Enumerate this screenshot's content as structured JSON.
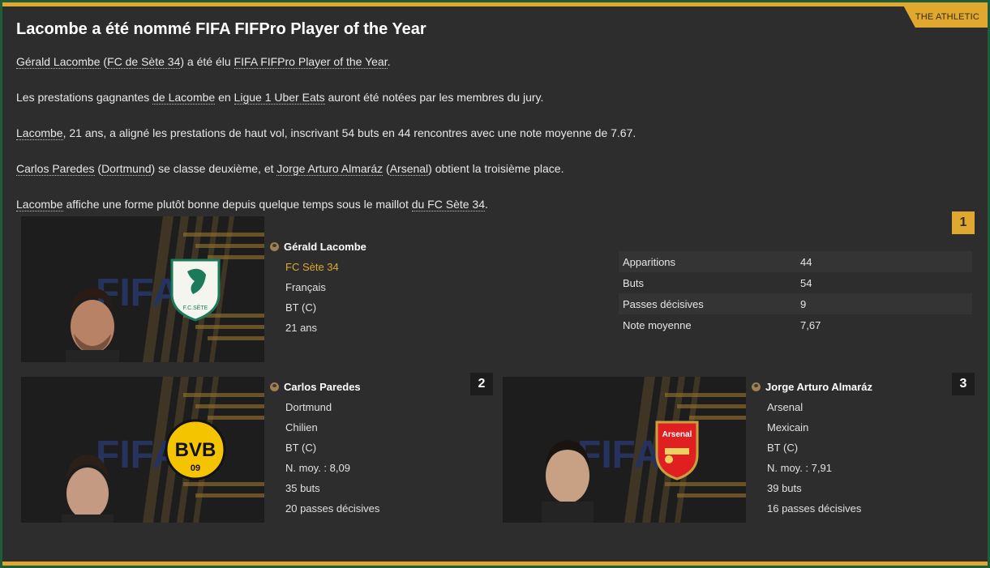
{
  "source": "THE ATHLETIC",
  "headline": "Lacombe a été nommé FIFA FIFPro Player of the Year",
  "paragraphs": {
    "p1": {
      "player": "Gérald Lacombe",
      "open": " (",
      "club": "FC de Sète 34",
      "mid": ") a été élu ",
      "award": "FIFA FIFPro Player of the Year",
      "end": "."
    },
    "p2": {
      "start": "Les prestations gagnantes ",
      "player": "de Lacombe",
      "mid": " en ",
      "league": "Ligue 1 Uber Eats",
      "end": " auront été notées par les membres du jury."
    },
    "p3": {
      "player": "Lacombe",
      "rest": ", 21 ans, a aligné les prestations de haut vol, inscrivant 54 buts en 44 rencontres avec une note moyenne de 7.67."
    },
    "p4": {
      "second": "Carlos Paredes",
      "open1": " (",
      "club2": "Dortmund",
      "mid": ") se classe deuxième, et ",
      "third": "Jorge Arturo Almaráz",
      "open2": " (",
      "club3": "Arsenal",
      "end": ") obtient la troisième place."
    },
    "p5": {
      "player": "Lacombe",
      "mid": " affiche une forme plutôt bonne depuis quelque temps sous le maillot ",
      "club": "du FC Sète 34",
      "end": "."
    }
  },
  "winner": {
    "rank": "1",
    "name": "Gérald Lacombe",
    "club": "FC Sète 34",
    "nationality": "Français",
    "position": "BT (C)",
    "age": "21 ans",
    "badge_text": "F.C.SÈTE",
    "banner_text": "FIFA",
    "stats": [
      {
        "label": "Apparitions",
        "value": "44"
      },
      {
        "label": "Buts",
        "value": "54"
      },
      {
        "label": "Passes décisives",
        "value": "9"
      },
      {
        "label": "Note moyenne",
        "value": "7,67"
      }
    ]
  },
  "runner_up": {
    "rank": "2",
    "name": "Carlos Paredes",
    "club": "Dortmund",
    "nationality": "Chilien",
    "position": "BT (C)",
    "rating": "N. moy. : 8,09",
    "goals": "35 buts",
    "assists": "20 passes décisives",
    "badge_text": "BVB",
    "badge_year": "09",
    "banner_text": "FIFA"
  },
  "third": {
    "rank": "3",
    "name": "Jorge Arturo Almaráz",
    "club": "Arsenal",
    "nationality": "Mexicain",
    "position": "BT (C)",
    "rating": "N. moy. : 7,91",
    "goals": "39 buts",
    "assists": "16 passes décisives",
    "badge_text": "Arsenal",
    "banner_text": "FIFA"
  },
  "colors": {
    "accent": "#e0a82e",
    "background": "#2d2d2d",
    "outer": "#1f5c3a"
  }
}
